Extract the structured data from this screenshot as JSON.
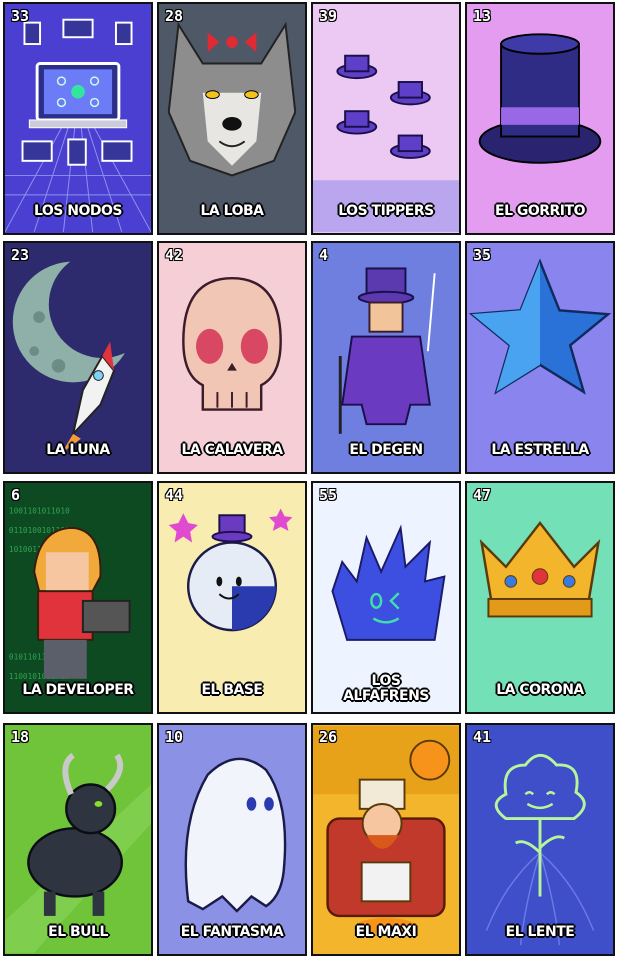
{
  "cards": [
    {
      "number": "33",
      "name": "LOS NODOS",
      "bg": "#4a3fd0",
      "icon": "laptops-network-icon"
    },
    {
      "number": "28",
      "name": "LA LOBA",
      "bg": "#4e5866",
      "icon": "wolf-icon"
    },
    {
      "number": "39",
      "name": "LOS TIPPERS",
      "bg": "#ecc9f2",
      "icon": "top-hats-icon"
    },
    {
      "number": "13",
      "name": "EL GORRITO",
      "bg": "#e39cf0",
      "icon": "top-hat-icon"
    },
    {
      "number": "23",
      "name": "LA LUNA",
      "bg": "#2e2a6e",
      "icon": "moon-rocket-icon"
    },
    {
      "number": "42",
      "name": "LA CALAVERA",
      "bg": "#f6cfd6",
      "icon": "skull-icon"
    },
    {
      "number": "4",
      "name": "EL DEGEN",
      "bg": "#6f7fe0",
      "icon": "gentleman-icon"
    },
    {
      "number": "35",
      "name": "LA ESTRELLA",
      "bg": "#8a84ee",
      "icon": "star-icon"
    },
    {
      "number": "6",
      "name": "LA DEVELOPER",
      "bg": "#0d4a22",
      "icon": "developer-icon"
    },
    {
      "number": "44",
      "name": "EL BASE",
      "bg": "#f8ecb0",
      "icon": "ball-character-icon"
    },
    {
      "number": "55",
      "name": "LOS ALFAFRENS",
      "bg": "#eef4ff",
      "icon": "blob-face-icon"
    },
    {
      "number": "47",
      "name": "LA CORONA",
      "bg": "#73e0b8",
      "icon": "crown-icon"
    },
    {
      "number": "18",
      "name": "EL BULL",
      "bg": "#6fc43a",
      "icon": "bull-icon"
    },
    {
      "number": "10",
      "name": "EL FANTASMA",
      "bg": "#8b92e6",
      "icon": "ghost-icon"
    },
    {
      "number": "26",
      "name": "EL MAXI",
      "bg": "#f2b52c",
      "icon": "bitcoin-king-icon"
    },
    {
      "number": "41",
      "name": "EL LENTE",
      "bg": "#3e4fc9",
      "icon": "lens-plant-icon"
    }
  ]
}
